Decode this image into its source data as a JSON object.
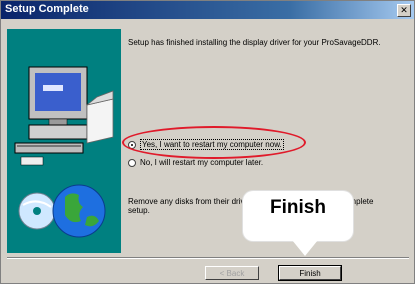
{
  "window": {
    "title": "Setup Complete",
    "close_glyph": "✕"
  },
  "body": {
    "message": "Setup has finished installing the display driver for your ProSavageDDR.",
    "options": [
      {
        "label": "Yes, I want to restart my computer now.",
        "selected": true
      },
      {
        "label": "No, I will restart my computer later.",
        "selected": false
      }
    ],
    "remove_disks_text": "Remove any disks from their drives, and then click Finish to complete setup."
  },
  "buttons": {
    "back": "< Back",
    "finish": "Finish"
  },
  "callout": {
    "text": "Finish"
  },
  "colors": {
    "title_bar": "#0a246a",
    "highlight_ring": "#e01a2a",
    "art_background": "#008080"
  },
  "icons": [
    "computer-icon",
    "globe-icon",
    "cd-disc-icon",
    "box-icon"
  ]
}
